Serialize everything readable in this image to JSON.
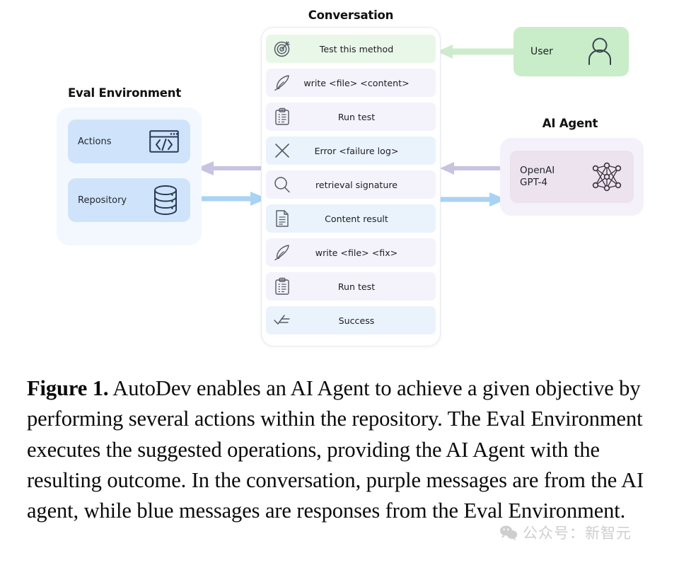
{
  "figure": {
    "conversation": {
      "title": "Conversation",
      "messages": [
        {
          "icon": "target-icon",
          "label": "Test this method",
          "source": "user"
        },
        {
          "icon": "feather-pen-icon",
          "label": "write <file> <content>",
          "source": "agent"
        },
        {
          "icon": "clipboard-icon",
          "label": "Run test",
          "source": "agent"
        },
        {
          "icon": "x-cross-icon",
          "label": "Error <failure log>",
          "source": "env"
        },
        {
          "icon": "magnifier-icon",
          "label": "retrieval signature",
          "source": "agent"
        },
        {
          "icon": "document-icon",
          "label": "Content result",
          "source": "env"
        },
        {
          "icon": "feather-pen-icon",
          "label": "write <file> <fix>",
          "source": "agent"
        },
        {
          "icon": "clipboard-icon",
          "label": "Run test",
          "source": "agent"
        },
        {
          "icon": "checklist-icon",
          "label": "Success",
          "source": "env"
        }
      ]
    },
    "eval_environment": {
      "title": "Eval Environment",
      "boxes": [
        {
          "label": "Actions",
          "icon": "code-window-icon"
        },
        {
          "label": "Repository",
          "icon": "database-icon"
        }
      ]
    },
    "user": {
      "label": "User",
      "icon": "person-icon"
    },
    "ai_agent": {
      "title": "AI Agent",
      "model_label": "OpenAI\nGPT-4",
      "icon": "neural-network-icon"
    },
    "colors": {
      "user_green": "#c9edc9",
      "message_user": "#e9f7e9",
      "message_agent": "#f4f2fb",
      "message_env": "#eaf3fc",
      "eval_box_blue": "#cfe4fb",
      "eval_panel_blue": "#f2f8fe",
      "agent_panel_purple": "#f4f1fa",
      "agent_inner_purple": "#ece3ef",
      "arrow_purple": "#c8c4e0",
      "arrow_blue": "#a9d3f3",
      "arrow_green": "#c9edc9"
    }
  },
  "caption": {
    "lead": "Figure 1.",
    "text": " AutoDev enables an AI Agent to achieve a given objective by performing several actions within the repository. The Eval Environment executes the suggested operations, providing the AI Agent with the resulting outcome. In the conversation, purple messages are from the AI agent, while blue messages are responses from the Eval Environment."
  },
  "watermark": {
    "text": "公众号：新智元"
  }
}
